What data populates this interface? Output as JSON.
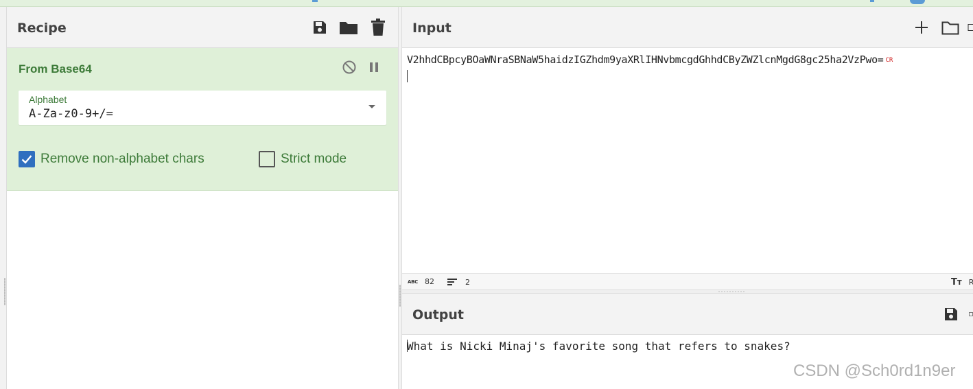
{
  "recipe": {
    "title": "Recipe",
    "operation": {
      "name": "From Base64",
      "alphabet_label": "Alphabet",
      "alphabet_value": "A-Za-z0-9+/=",
      "remove_non_alphabet_label": "Remove non-alphabet chars",
      "remove_non_alphabet_checked": true,
      "strict_mode_label": "Strict mode",
      "strict_mode_checked": false
    }
  },
  "input": {
    "title": "Input",
    "text": "V2hhdCBpcyBOaWNraSBNaW5haidzIGZhdm9yaXRlIHNvbmcgdGhhdCByZWZlcnMgdG8gc25ha2VzPwo=",
    "line_end_marker": "CR",
    "status": {
      "char_count": "82",
      "line_count": "2",
      "right_label": "R"
    }
  },
  "output": {
    "title": "Output",
    "text": "What is Nicki Minaj's favorite song that refers to snakes?"
  },
  "watermark": "CSDN @Sch0rd1n9er",
  "colors": {
    "operation_bg": "#dff0d8",
    "operation_text": "#3c7a38",
    "checkbox_on": "#2f6fbf"
  }
}
